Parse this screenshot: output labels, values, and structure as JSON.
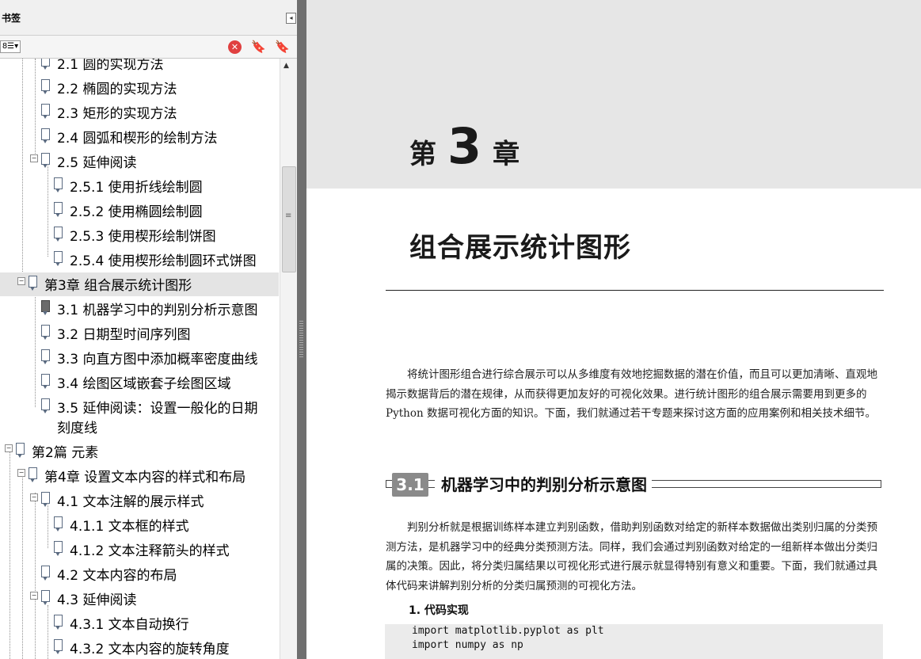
{
  "panel": {
    "title": "书签",
    "collapse_glyph": "◂",
    "toolbar": {
      "options_label": "8☰▾",
      "delete_glyph": "✕",
      "new_bookmark_glyph": "🔖",
      "expand_glyph": "🔖"
    }
  },
  "bookmarks": [
    {
      "label": "2.1  圆的实现方法"
    },
    {
      "label": "2.2  椭圆的实现方法"
    },
    {
      "label": "2.3  矩形的实现方法"
    },
    {
      "label": "2.4  圆弧和楔形的绘制方法"
    },
    {
      "label": "2.5  延伸阅读",
      "toggle": "−"
    },
    {
      "label": "2.5.1  使用折线绘制圆"
    },
    {
      "label": "2.5.2  使用椭圆绘制圆"
    },
    {
      "label": "2.5.3  使用楔形绘制饼图"
    },
    {
      "label": "2.5.4  使用楔形绘制圆环式饼图"
    },
    {
      "label": "第3章  组合展示统计图形",
      "toggle": "−"
    },
    {
      "label": "3.1  机器学习中的判别分析示意图"
    },
    {
      "label": "3.2  日期型时间序列图"
    },
    {
      "label": "3.3  向直方图中添加概率密度曲线"
    },
    {
      "label": "3.4  绘图区域嵌套子绘图区域"
    },
    {
      "label": "3.5  延伸阅读：设置一般化的日期"
    },
    {
      "label": "刻度线"
    },
    {
      "label": "第2篇  元素",
      "toggle": "−"
    },
    {
      "label": "第4章  设置文本内容的样式和布局",
      "toggle": "−"
    },
    {
      "label": "4.1  文本注解的展示样式",
      "toggle": "−"
    },
    {
      "label": "4.1.1  文本框的样式"
    },
    {
      "label": "4.1.2  文本注释箭头的样式"
    },
    {
      "label": "4.2  文本内容的布局"
    },
    {
      "label": "4.3  延伸阅读",
      "toggle": "−"
    },
    {
      "label": "4.3.1  文本自动换行"
    },
    {
      "label": "4.3.2  文本内容的旋转角度"
    }
  ],
  "scrollbar": {
    "up_glyph": "▲",
    "grip_glyph": "≡"
  },
  "document": {
    "chapter_prefix": "第",
    "chapter_number": "3",
    "chapter_suffix": "章",
    "chapter_title": "组合展示统计图形",
    "intro_paragraph": "将统计图形组合进行综合展示可以从多维度有效地挖掘数据的潜在价值，而且可以更加清晰、直观地揭示数据背后的潜在规律，从而获得更加友好的可视化效果。进行统计图形的组合展示需要用到更多的 Python 数据可视化方面的知识。下面，我们就通过若干专题来探讨这方面的应用案例和相关技术细节。",
    "section_number": "3.1",
    "section_title": "机器学习中的判别分析示意图",
    "section_paragraph": "判别分析就是根据训练样本建立判别函数，借助判别函数对给定的新样本数据做出类别归属的分类预测方法，是机器学习中的经典分类预测方法。同样，我们会通过判别函数对给定的一组新样本做出分类归属的决策。因此，将分类归属结果以可视化形式进行展示就显得特别有意义和重要。下面，我们就通过具体代码来讲解判别分析的分类归属预测的可视化方法。",
    "subheading": "1. 代码实现",
    "code_lines": [
      "import matplotlib.pyplot as plt",
      "import numpy as np"
    ]
  }
}
